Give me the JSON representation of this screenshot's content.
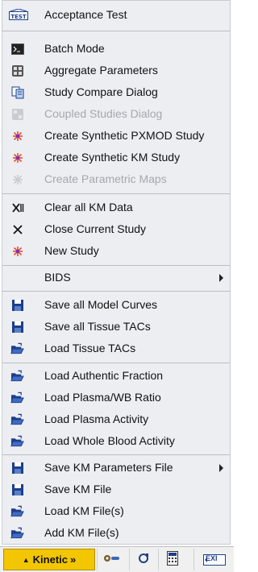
{
  "menu": {
    "items": [
      {
        "label": "Acceptance Test",
        "icon": "test-icon"
      },
      {
        "label": "Batch Mode",
        "icon": "terminal-icon"
      },
      {
        "label": "Aggregate Parameters",
        "icon": "aggregate-icon"
      },
      {
        "label": "Study Compare Dialog",
        "icon": "compare-icon"
      },
      {
        "label": "Coupled Studies Dialog",
        "icon": "coupled-icon",
        "disabled": true
      },
      {
        "label": "Create Synthetic PXMOD Study",
        "icon": "spark-icon"
      },
      {
        "label": "Create Synthetic KM Study",
        "icon": "spark-icon"
      },
      {
        "label": "Create Parametric Maps",
        "icon": "spark-icon",
        "disabled": true
      },
      {
        "label": "Clear all KM Data",
        "icon": "clear-all-icon"
      },
      {
        "label": "Close Current Study",
        "icon": "close-icon"
      },
      {
        "label": "New Study",
        "icon": "spark-icon"
      },
      {
        "label": "BIDS",
        "icon": ""
      },
      {
        "label": "Save all Model Curves",
        "icon": "floppy-icon"
      },
      {
        "label": "Save all Tissue TACs",
        "icon": "floppy-icon"
      },
      {
        "label": "Load Tissue TACs",
        "icon": "open-folder-icon"
      },
      {
        "label": "Load Authentic Fraction",
        "icon": "open-folder-icon"
      },
      {
        "label": "Load Plasma/WB Ratio",
        "icon": "open-folder-icon"
      },
      {
        "label": "Load Plasma Activity",
        "icon": "open-folder-icon"
      },
      {
        "label": "Load Whole Blood Activity",
        "icon": "open-folder-icon"
      },
      {
        "label": "Save KM Parameters File",
        "icon": "floppy-icon"
      },
      {
        "label": "Save KM File",
        "icon": "floppy-icon"
      },
      {
        "label": "Load KM File(s)",
        "icon": "open-folder-icon"
      },
      {
        "label": "Add KM File(s)",
        "icon": "open-folder-icon"
      }
    ]
  },
  "taskbar": {
    "kinetic_label": "Kinetic",
    "kinetic_caret": "▲",
    "kinetic_chevron": "»",
    "exit_label": "EXI"
  },
  "colors": {
    "menu_bg": "#eceef2",
    "kinetic_bg": "#f2c600",
    "floppy": "#1a3f8c",
    "spark": "#e5502a"
  }
}
